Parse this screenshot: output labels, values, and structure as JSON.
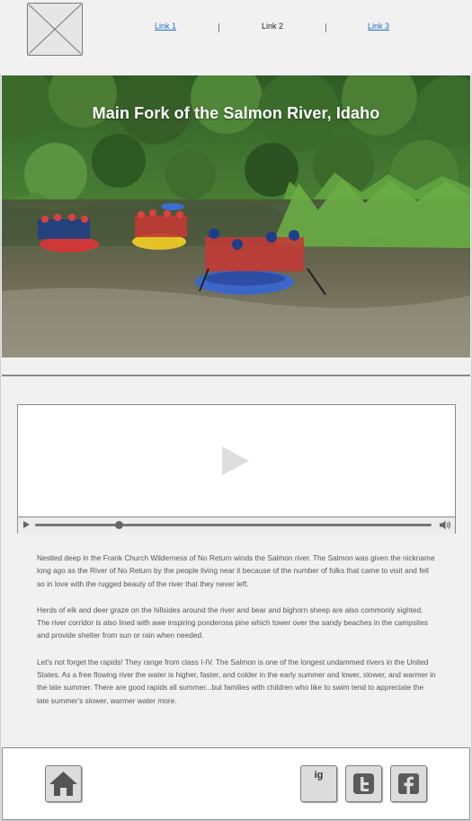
{
  "nav": {
    "links": [
      {
        "label": "Link 1",
        "current": false
      },
      {
        "label": "Link 2",
        "current": true
      },
      {
        "label": "Link 3",
        "current": false
      }
    ]
  },
  "hero": {
    "title": "Main Fork of the Salmon River, Idaho"
  },
  "video": {
    "progress": 0.21
  },
  "content": {
    "paragraphs": [
      "Nestled deep in the Frank Church Wilderness of No Return winds the Salmon river. The Salmon was given the nickname long ago as the River of No Return by the people living near it because of the number of folks that came to visit and fell so in love with the rugged beauty of the river that they never left.",
      "Herds of elk and deer graze on the hillsides around the river and bear and bighorn sheep are also commonly sighted. The river corridor is also lined with awe inspiring ponderosa pine which tower over the sandy beaches in the campsites and provide shelter from sun or rain when needed.",
      "Let's not forget the rapids! They range from class I-IV. The Salmon is one of the longest undammed rivers in the United States. As a free flowing river the water is higher, faster, and colder in the early summer and lower, slower, and warmer in the late summer. There are good rapids all summer...but families with children who like to swim tend to appreciate the late summer's slower, warmer water more."
    ]
  },
  "footer": {
    "home_icon": "home-icon",
    "instagram_label": "ig",
    "twitter_icon": "twitter-icon",
    "facebook_icon": "facebook-icon"
  }
}
